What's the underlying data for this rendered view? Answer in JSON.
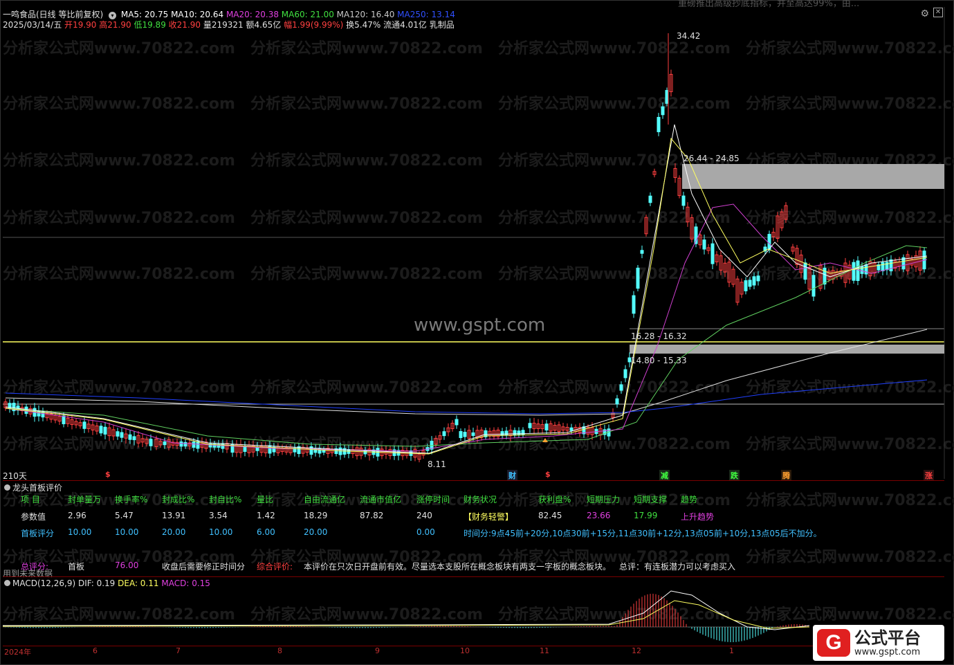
{
  "top_banner": "重磅推出高级抄底指标，并至高达99%，由...",
  "stock": {
    "name": "一鸣食品(日线 等比前复权)",
    "date": "2025/03/14/五",
    "open_label": "开",
    "open": "19.90",
    "high_label": "高",
    "high": "21.90",
    "low_label": "低",
    "low": "19.89",
    "close_label": "收",
    "close": "21.90",
    "vol_label": "量",
    "vol": "219321",
    "amt_label": "额",
    "amt": "4.65亿",
    "chg_label": "幅",
    "chg": "1.99(9.99%)",
    "turn_label": "换",
    "turn": "5.47%",
    "float_label": "流通",
    "float": "4.01亿",
    "sector": "乳制品"
  },
  "ma_legend": [
    {
      "text": "MA5: 20.75",
      "color": "#ffffff"
    },
    {
      "text": "MA10: 20.64",
      "color": "#ffffff"
    },
    {
      "text": "MA20: 20.38",
      "color": "#e040e0"
    },
    {
      "text": "MA60: 21.00",
      "color": "#40e040"
    },
    {
      "text": "MA120: 16.40",
      "color": "#c8c8c8"
    },
    {
      "text": "MA250: 13.14",
      "color": "#3050ff"
    }
  ],
  "watermark": "分析家公式网www.70822.com",
  "center_watermark": "www.gspt.com",
  "price_labels": {
    "peak": "34.42",
    "low": "8.11",
    "zone_high": "26.44 - 24.85",
    "zone_mid": "16.28 - 16.32",
    "zone_low": "14.80 - 15.33"
  },
  "period_label": "210天",
  "signals": [
    {
      "text": "$",
      "color": "#ff4040"
    },
    {
      "text": "财",
      "color": "#40c0ff"
    },
    {
      "text": "$",
      "color": "#ff4040"
    },
    {
      "text": "减",
      "color": "#40ff40"
    },
    {
      "text": "跌",
      "color": "#40ff40"
    },
    {
      "text": "腾",
      "color": "#ffa030"
    },
    {
      "text": "涨",
      "color": "#ff4040"
    }
  ],
  "panel": {
    "title": "龙头首板评价",
    "headers": [
      "项 目",
      "封单量万",
      "换手率%",
      "封成比%",
      "封自比%",
      "量比",
      "自由流通亿",
      "流通市值亿",
      "涨停时间",
      "财务状况",
      "获利盘%",
      "短期压力",
      "短期支撑",
      "趋势"
    ],
    "row1_label": "参数值",
    "row1": [
      "2.96",
      "5.47",
      "13.91",
      "3.54",
      "1.42",
      "18.29",
      "87.82",
      "240",
      "【财务轻警】",
      "82.45",
      "23.66",
      "17.99",
      "上升趋势"
    ],
    "row2_label": "首板评分",
    "row2": [
      "10.00",
      "10.00",
      "20.00",
      "10.00",
      "6.00",
      "20.00",
      "",
      "0.00"
    ],
    "time_note": "时间分:9点45前+20分,10点30前+15分,11点30前+12分,13点05前+10分,13点05后不加分。",
    "total_label": "总评分:",
    "total_type": "首板",
    "total_score": "76.00",
    "close_note": "收盘后需要修正时间分",
    "eval_label": "综合评价:",
    "eval_text": "本评价在只次日开盘前有效。尽量选本支股所在概念板块有两支一字板的概念板块。",
    "summary": "总评：有连板潜力可以考虑买入",
    "future_note": "用到未来数据"
  },
  "macd": {
    "label": "MACD(12,26,9)",
    "dif": "DIF: 0.19",
    "dea": "DEA: 0.11",
    "macd": "MACD: 0.15"
  },
  "months": [
    "2024年",
    "6",
    "7",
    "8",
    "9",
    "10",
    "11",
    "12",
    "1"
  ],
  "logo": {
    "title": "公式平台",
    "url": "www.gspt.com",
    "mark": "G"
  },
  "colors": {
    "up": "#ff4040",
    "down": "#54ffff",
    "yellow": "#ffff60",
    "grey_zone": "#a8a8a8",
    "ma250": "#2040ff"
  }
}
